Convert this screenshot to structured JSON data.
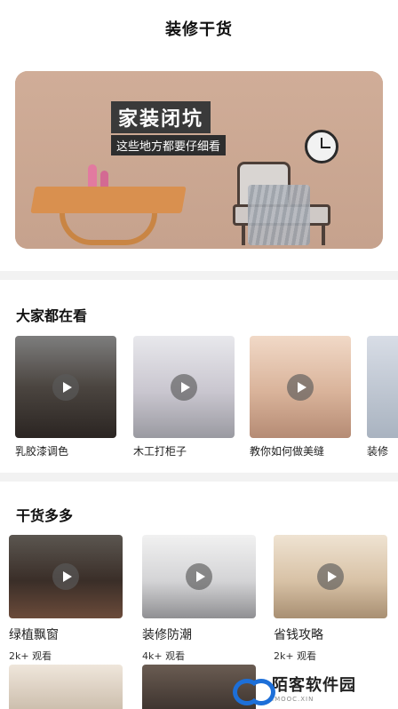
{
  "header": {
    "title": "装修干货"
  },
  "banner": {
    "title": "家装闭坑",
    "subtitle": "这些地方都要仔细看"
  },
  "section_trending": {
    "title": "大家都在看",
    "items": [
      {
        "label": "乳胶漆调色"
      },
      {
        "label": "木工打柜子"
      },
      {
        "label": "教你如何做美缝"
      },
      {
        "label": "装修"
      }
    ]
  },
  "section_tips": {
    "title": "干货多多",
    "items": [
      {
        "label": "绿植飘窗",
        "views": "2k+ 观看"
      },
      {
        "label": "装修防潮",
        "views": "4k+ 观看"
      },
      {
        "label": "省钱攻略",
        "views": "2k+ 观看"
      }
    ]
  },
  "watermark": {
    "main": "陌客软件园",
    "sub": "IMOOC.XIN"
  },
  "colors": {
    "banner_bg": "#c9a591",
    "divider": "#f2f2f2",
    "watermark_blue": "#1d6fd8"
  }
}
